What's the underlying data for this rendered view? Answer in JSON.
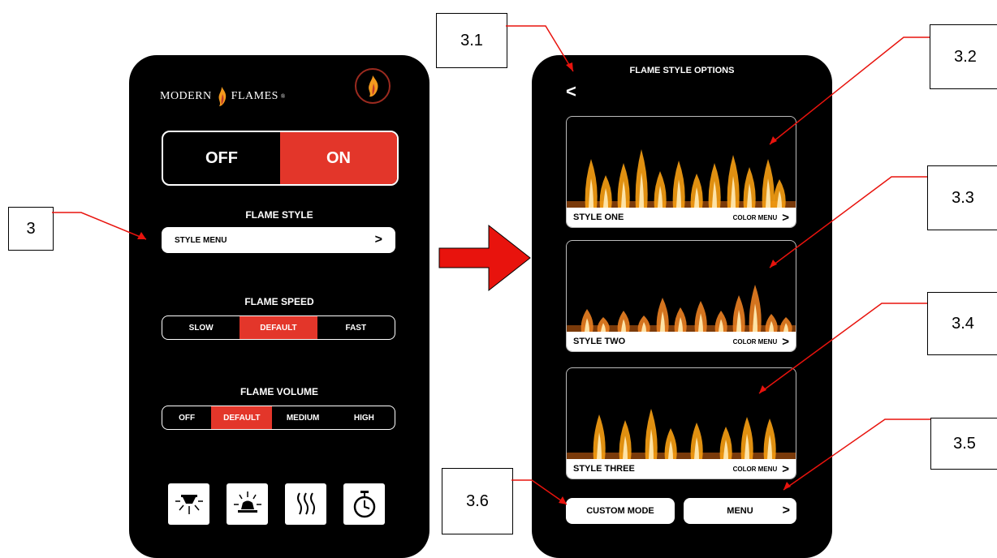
{
  "left_phone": {
    "logo_text_1": "MODERN",
    "logo_text_2": "FLAMES",
    "logo_reg": "®",
    "power": {
      "off": "OFF",
      "on": "ON",
      "selected": "ON"
    },
    "flame_style": {
      "label": "FLAME STYLE",
      "menu": "STYLE MENU",
      "chevron": ">"
    },
    "flame_speed": {
      "label": "FLAME SPEED",
      "options": [
        "SLOW",
        "DEFAULT",
        "FAST"
      ],
      "selected": "DEFAULT"
    },
    "flame_volume": {
      "label": "FLAME VOLUME",
      "options": [
        "OFF",
        "DEFAULT",
        "MEDIUM",
        "HIGH"
      ],
      "selected": "DEFAULT"
    },
    "icons": [
      "ceiling-light-icon",
      "lamp-light-icon",
      "heat-icon",
      "timer-icon"
    ]
  },
  "right_phone": {
    "back": "<",
    "title": "FLAME STYLE OPTIONS",
    "styles": [
      {
        "name": "STYLE ONE",
        "color_menu": "COLOR MENU",
        "chevron": ">"
      },
      {
        "name": "STYLE TWO",
        "color_menu": "COLOR MENU",
        "chevron": ">"
      },
      {
        "name": "STYLE THREE",
        "color_menu": "COLOR MENU",
        "chevron": ">"
      }
    ],
    "custom_mode": "CUSTOM MODE",
    "menu": "MENU",
    "menu_chevron": ">"
  },
  "callouts": [
    "3",
    "3.1",
    "3.2",
    "3.3",
    "3.4",
    "3.5",
    "3.6"
  ],
  "colors": {
    "accent": "#e3362a",
    "arrow": "#e8130d",
    "leader": "#e8130d",
    "phone_bg": "#000000"
  }
}
